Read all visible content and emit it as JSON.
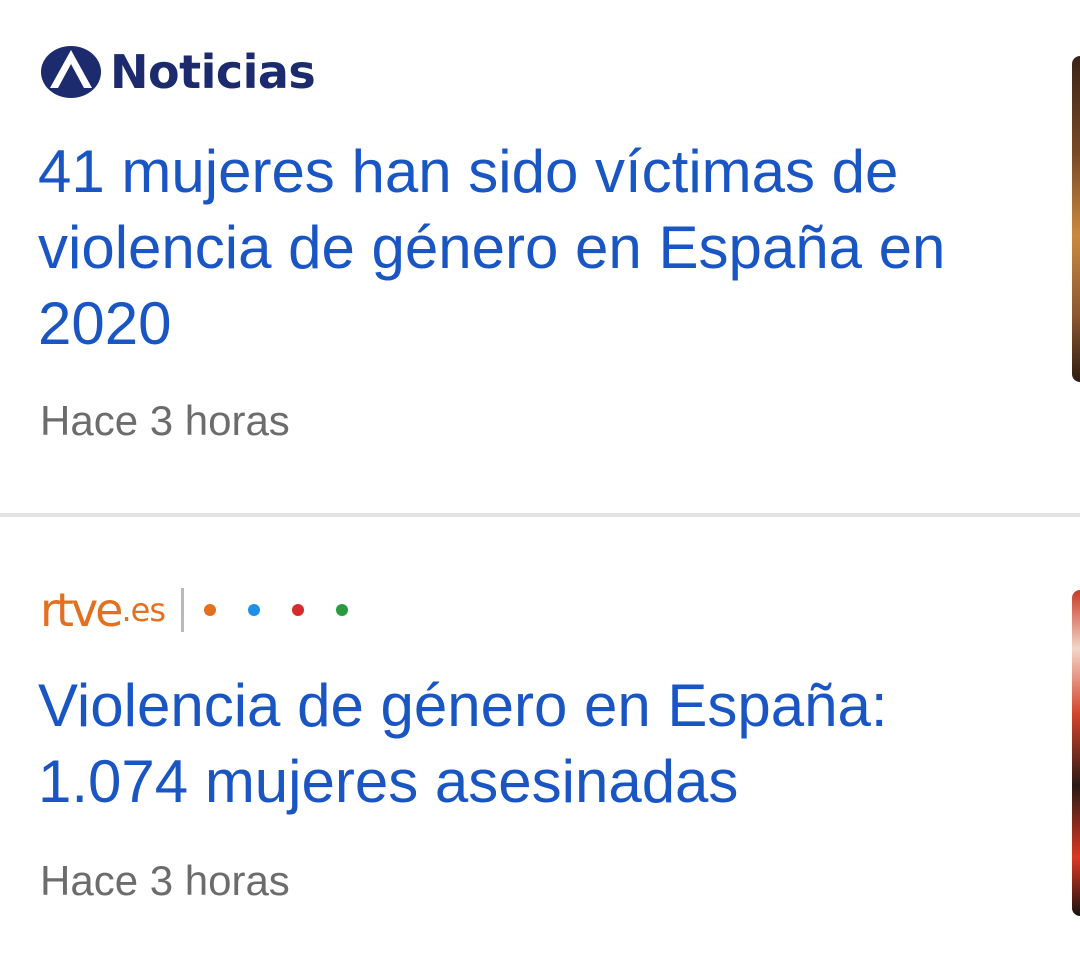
{
  "articles": [
    {
      "source": {
        "name": "Noticias",
        "logo_icon": "antena3-triangle-logo-icon",
        "brand_color": "#1c2a6e"
      },
      "headline": "41 mujeres han sido víctimas de violencia de género en España en 2020",
      "time": "Hace 3 horas"
    },
    {
      "source": {
        "name": "rtve",
        "suffix": ".es",
        "brand_color": "#e46f1f",
        "dot_colors": [
          "#e46f1f",
          "#1e90e6",
          "#d52b2b",
          "#2a9a3f"
        ]
      },
      "headline": "Violencia de género en España: 1.074 mujeres asesinadas",
      "time": "Hace 3 horas"
    }
  ],
  "colors": {
    "headline": "#1a55c4",
    "timestamp": "#6c6c6c",
    "divider": "#e3e3e3"
  }
}
